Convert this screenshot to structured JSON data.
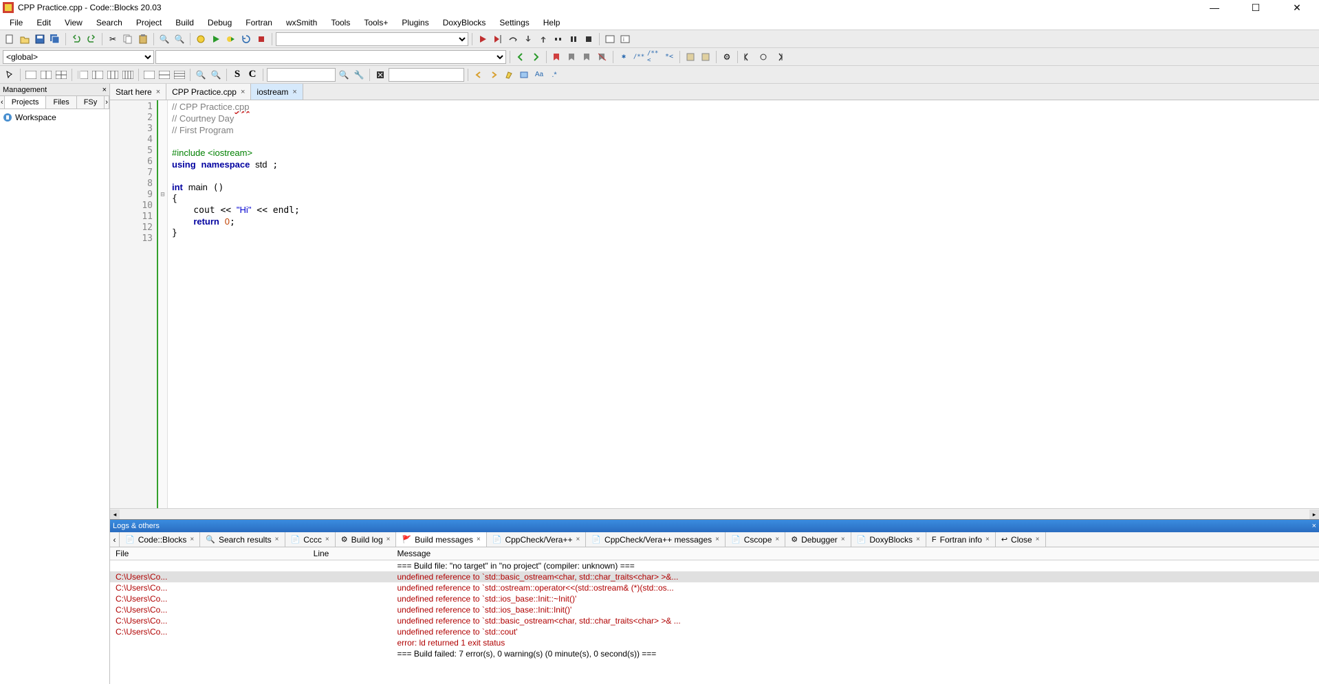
{
  "window": {
    "title": "CPP Practice.cpp - Code::Blocks 20.03"
  },
  "menus": [
    "File",
    "Edit",
    "View",
    "Search",
    "Project",
    "Build",
    "Debug",
    "Fortran",
    "wxSmith",
    "Tools",
    "Tools+",
    "Plugins",
    "DoxyBlocks",
    "Settings",
    "Help"
  ],
  "scope_selector": "<global>",
  "management": {
    "title": "Management",
    "tabs": [
      "Projects",
      "Files",
      "FSy"
    ],
    "active_tab": "Projects",
    "workspace_label": "Workspace"
  },
  "editor_tabs": [
    {
      "label": "Start here",
      "active": false,
      "closable": true
    },
    {
      "label": "CPP Practice.cpp",
      "active": false,
      "closable": true
    },
    {
      "label": "iostream",
      "active": true,
      "closable": true
    }
  ],
  "code": {
    "lines": [
      {
        "n": 1,
        "html": "<span class='c-comment'>// CPP Practice.<span class='err-underline'>cpp</span></span>"
      },
      {
        "n": 2,
        "html": "<span class='c-comment'>// Courtney Day</span>"
      },
      {
        "n": 3,
        "html": "<span class='c-comment'>// First Program</span>"
      },
      {
        "n": 4,
        "html": ""
      },
      {
        "n": 5,
        "html": "<span class='c-pp'>#include &lt;iostream&gt;</span>"
      },
      {
        "n": 6,
        "html": "<span class='c-kw'>using</span> <span class='c-kw'>namespace</span> <span class='c-id'>std</span> ;"
      },
      {
        "n": 7,
        "html": ""
      },
      {
        "n": 8,
        "html": "<span class='c-kw'>int</span> <span class='c-id'>main</span> ()"
      },
      {
        "n": 9,
        "html": "{",
        "fold": "⊟"
      },
      {
        "n": 10,
        "html": "    cout &lt;&lt; <span class='c-str'>\"Hi\"</span> &lt;&lt; endl;"
      },
      {
        "n": 11,
        "html": "    <span class='c-kw'>return</span> <span class='c-num'>0</span>;"
      },
      {
        "n": 12,
        "html": "}"
      },
      {
        "n": 13,
        "html": ""
      }
    ]
  },
  "logs": {
    "header": "Logs & others",
    "tabs": [
      "Code::Blocks",
      "Search results",
      "Cccc",
      "Build log",
      "Build messages",
      "CppCheck/Vera++",
      "CppCheck/Vera++ messages",
      "Cscope",
      "Debugger",
      "DoxyBlocks",
      "Fortran info",
      "Close"
    ],
    "active_tab": "Build messages",
    "columns": [
      "File",
      "Line",
      "Message"
    ],
    "rows": [
      {
        "file": "",
        "line": "",
        "msg": "=== Build file: \"no target\" in \"no project\" (compiler: unknown) ===",
        "err": false
      },
      {
        "file": "C:\\Users\\Co...",
        "line": "",
        "msg": "  undefined reference to `std::basic_ostream<char, std::char_traits<char> >&...",
        "err": true,
        "sel": true
      },
      {
        "file": "C:\\Users\\Co...",
        "line": "",
        "msg": "  undefined reference to `std::ostream::operator<<(std::ostream& (*)(std::os...",
        "err": true
      },
      {
        "file": "C:\\Users\\Co...",
        "line": "",
        "msg": "  undefined reference to `std::ios_base::Init::~Init()'",
        "err": true
      },
      {
        "file": "C:\\Users\\Co...",
        "line": "",
        "msg": "  undefined reference to `std::ios_base::Init::Init()'",
        "err": true
      },
      {
        "file": "C:\\Users\\Co...",
        "line": "",
        "msg": "undefined reference to `std::basic_ostream<char, std::char_traits<char> >& ...",
        "err": true
      },
      {
        "file": "C:\\Users\\Co...",
        "line": "",
        "msg": "undefined reference to `std::cout'",
        "err": true
      },
      {
        "file": "",
        "line": "",
        "msg": "error: ld returned 1 exit status",
        "err": true
      },
      {
        "file": "",
        "line": "",
        "msg": "=== Build failed: 7 error(s), 0 warning(s) (0 minute(s), 0 second(s)) ===",
        "err": false
      }
    ]
  },
  "log_tab_icons": {
    "Code::Blocks": "📄",
    "Search results": "🔍",
    "Cccc": "📄",
    "Build log": "⚙",
    "Build messages": "🚩",
    "CppCheck/Vera++": "📄",
    "CppCheck/Vera++ messages": "📄",
    "Cscope": "📄",
    "Debugger": "⚙",
    "DoxyBlocks": "📄",
    "Fortran info": "F",
    "Close": "↩"
  }
}
